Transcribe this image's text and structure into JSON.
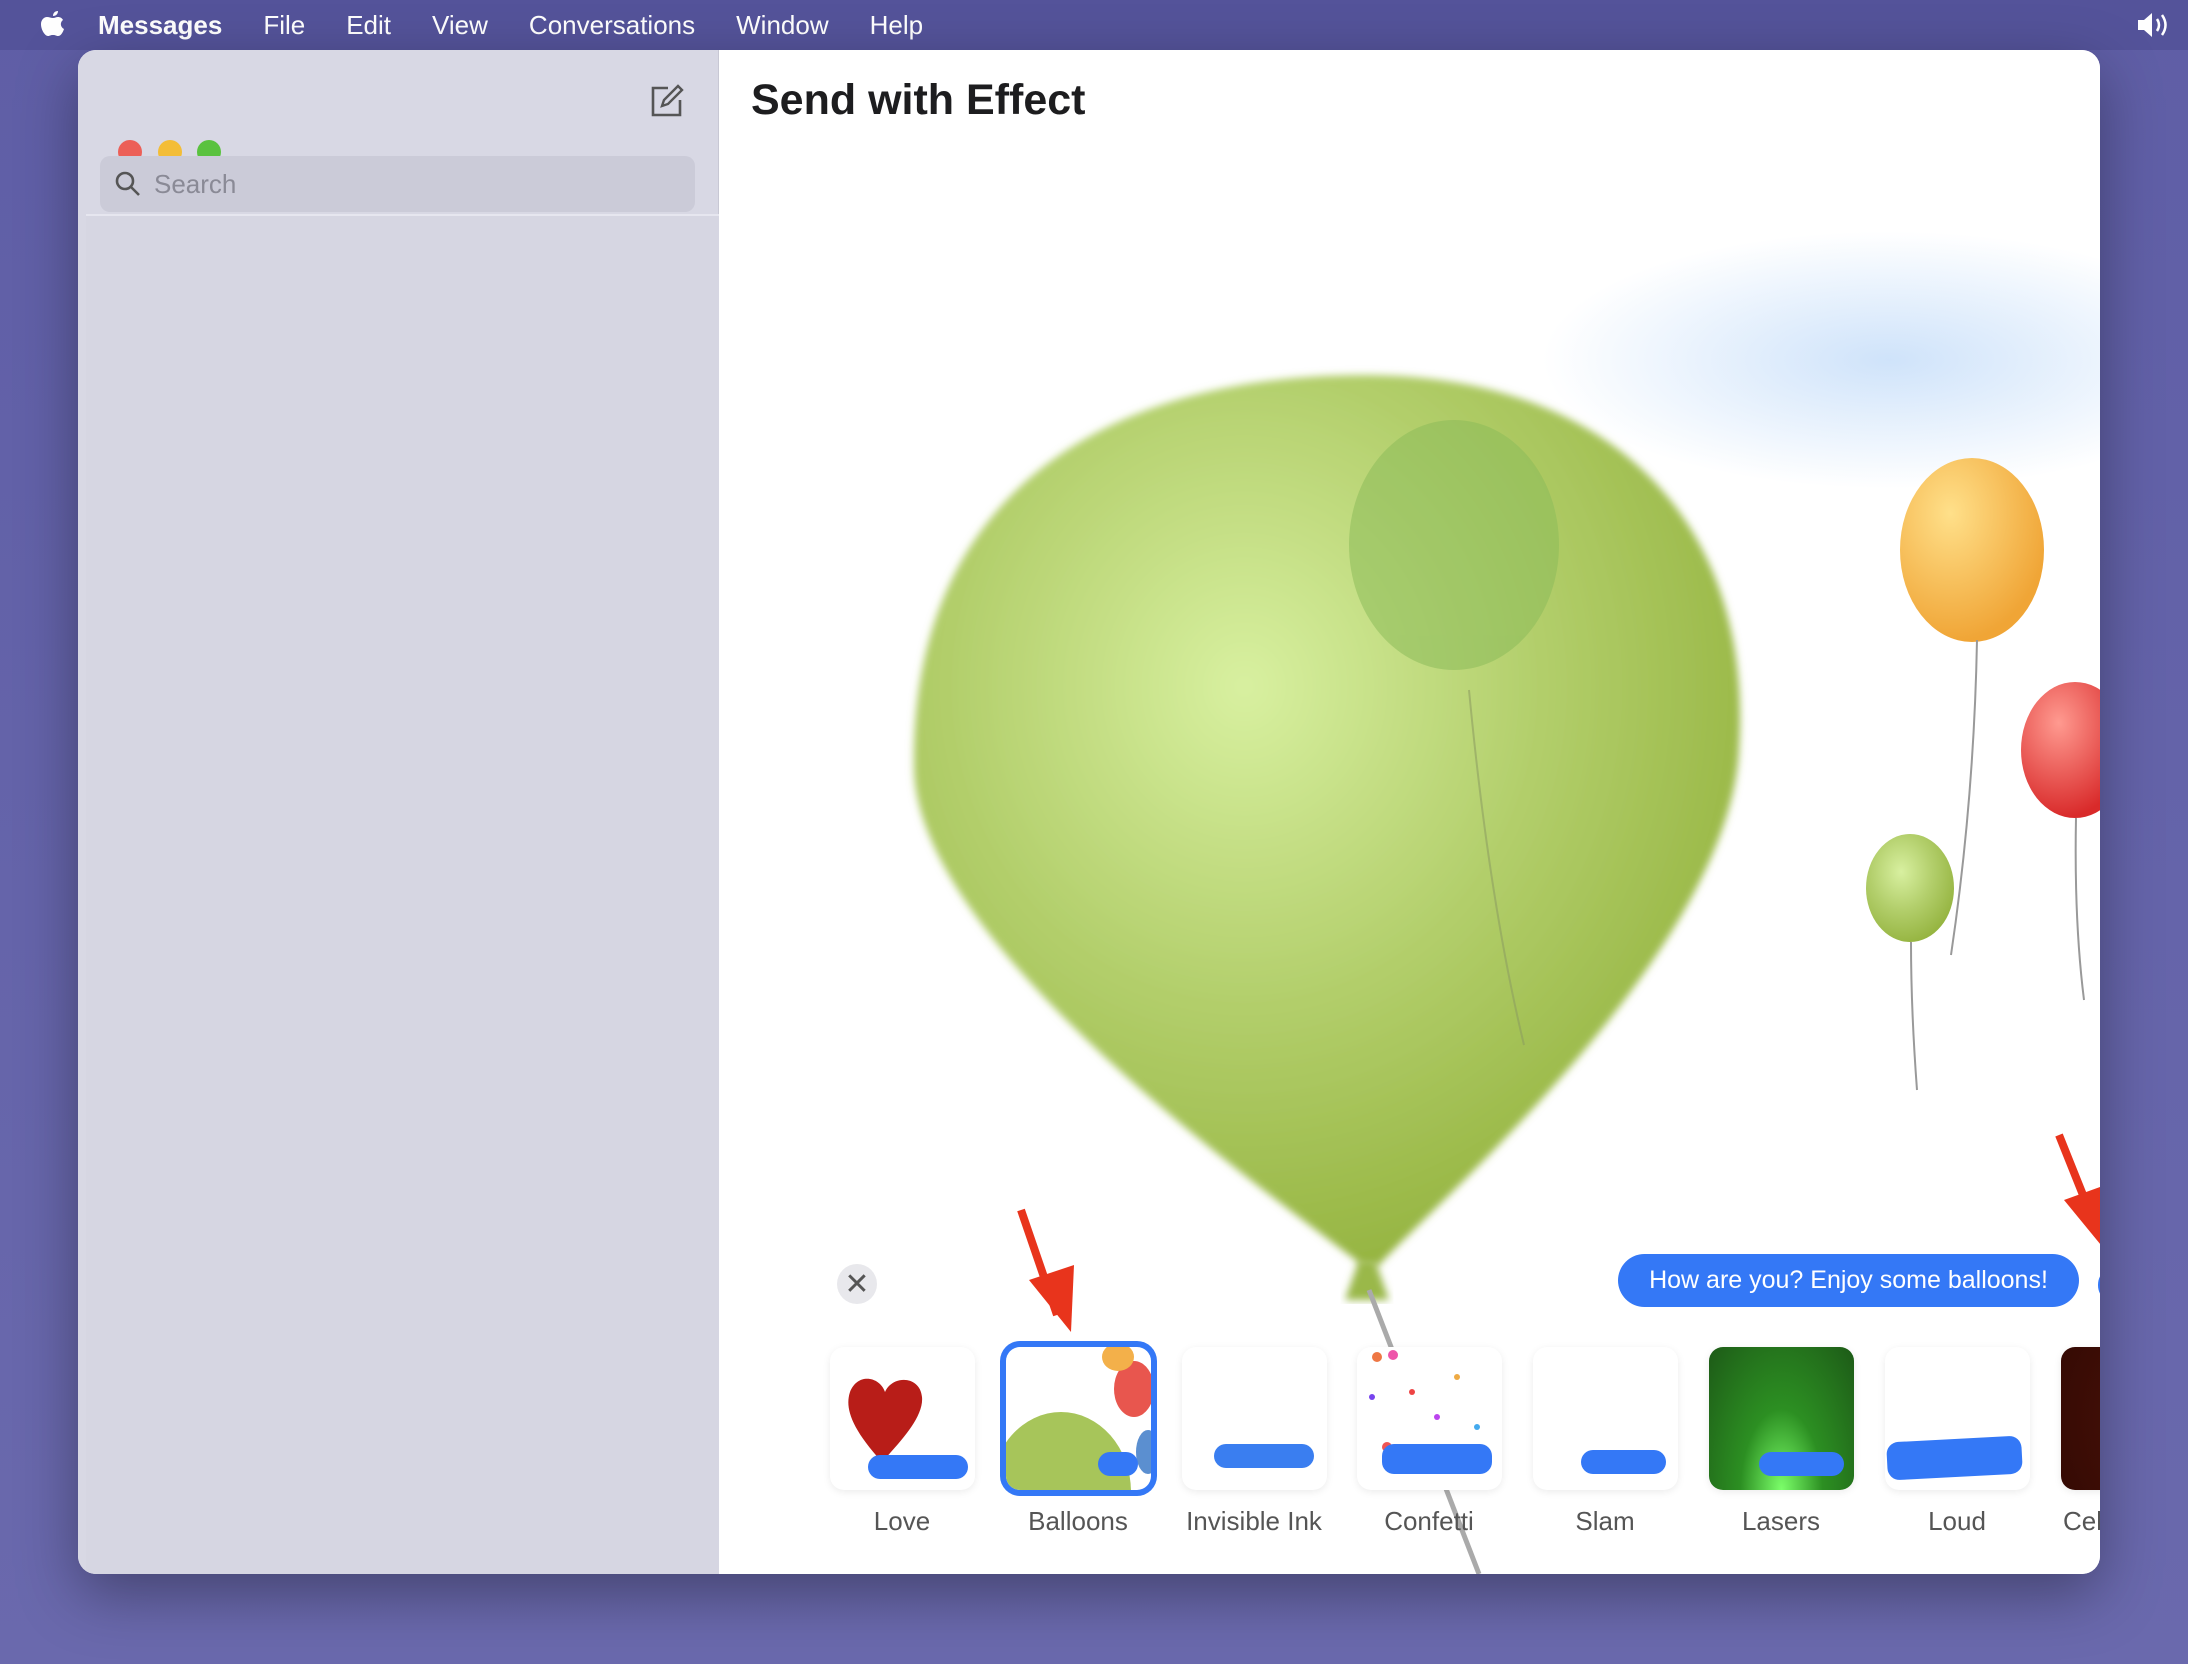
{
  "menubar": {
    "app": "Messages",
    "items": [
      "File",
      "Edit",
      "View",
      "Conversations",
      "Window",
      "Help"
    ]
  },
  "sidebar": {
    "search_placeholder": "Search"
  },
  "main": {
    "title": "Send with Effect",
    "message": "How are you? Enjoy some balloons!"
  },
  "effects": [
    {
      "label": "Love",
      "selected": false
    },
    {
      "label": "Balloons",
      "selected": true
    },
    {
      "label": "Invisible Ink",
      "selected": false
    },
    {
      "label": "Confetti",
      "selected": false
    },
    {
      "label": "Slam",
      "selected": false
    },
    {
      "label": "Lasers",
      "selected": false
    },
    {
      "label": "Loud",
      "selected": false
    },
    {
      "label": "Celebration",
      "selected": false
    }
  ],
  "colors": {
    "accent": "#3478f6",
    "menubar": "#54539a",
    "desktop": "#6665aa",
    "annotation_arrow": "#e8341c"
  }
}
